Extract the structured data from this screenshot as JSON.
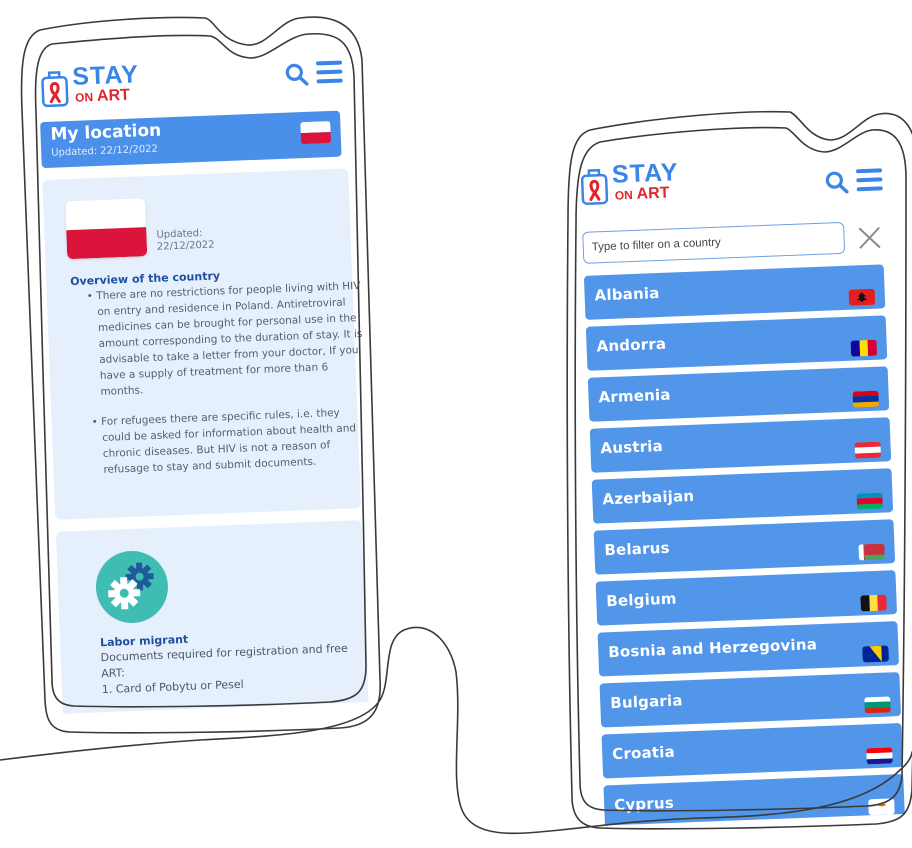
{
  "app": {
    "logo_word": "STAY",
    "logo_on": "ON",
    "logo_art": "ART",
    "brand_blue": "#3b85e6",
    "brand_red": "#e0252d"
  },
  "location_screen": {
    "title": "My location",
    "updated_label": "Updated: 22/12/2022",
    "card_updated_line1": "Updated:",
    "card_updated_line2": "22/12/2022",
    "overview_title": "Overview of the country",
    "bullets": [
      "There are no restrictions for people living with HIV on entry and residence in Poland. Antiretroviral medicines can be brought for personal use in the amount corresponding to the duration of stay.  It is advisable to take a letter from your doctor, If you have a supply of treatment for more than 6 months.",
      "For refugees there are specific rules, i.e. they could be asked for information about health and chronic diseases. But HIV is not a reason of refusage to stay and submit documents."
    ],
    "labor_title": "Labor migrant",
    "labor_text": "Documents required for registration and free ART:",
    "labor_item": "1. Card of Pobytu or Pesel",
    "country_flag": "poland-flag"
  },
  "country_screen": {
    "filter_placeholder": "Type to filter on a country",
    "countries": [
      {
        "name": "Albania",
        "flag": "albania-flag"
      },
      {
        "name": "Andorra",
        "flag": "andorra-flag"
      },
      {
        "name": "Armenia",
        "flag": "armenia-flag"
      },
      {
        "name": "Austria",
        "flag": "austria-flag"
      },
      {
        "name": "Azerbaijan",
        "flag": "azerbaijan-flag"
      },
      {
        "name": "Belarus",
        "flag": "belarus-flag"
      },
      {
        "name": "Belgium",
        "flag": "belgium-flag"
      },
      {
        "name": "Bosnia and Herzegovina",
        "flag": "bosnia-flag"
      },
      {
        "name": "Bulgaria",
        "flag": "bulgaria-flag"
      },
      {
        "name": "Croatia",
        "flag": "croatia-flag"
      },
      {
        "name": "Cyprus",
        "flag": "cyprus-flag"
      }
    ],
    "row_color": "#5296ea"
  }
}
